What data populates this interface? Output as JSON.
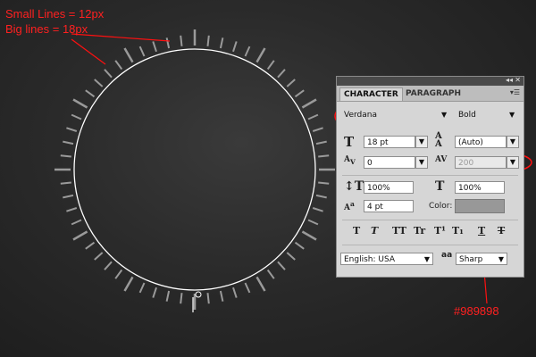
{
  "annotations": {
    "line1": "Small Lines = 12px",
    "line2": "Big lines = 18px",
    "color_note": "#989898",
    "accent_color": "#ff2020"
  },
  "panel": {
    "tabs": [
      {
        "label": "CHARACTER",
        "active": true
      },
      {
        "label": "PARAGRAPH",
        "active": false
      }
    ],
    "font_family": "Verdana",
    "font_style": "Bold",
    "font_size": "18 pt",
    "leading": "(Auto)",
    "kerning": "0",
    "tracking": "200",
    "vertical_scale": "100%",
    "horizontal_scale": "100%",
    "baseline_shift": "4 pt",
    "color_label": "Color:",
    "color_value": "#989898",
    "language": "English: USA",
    "antialias_icon_text": "a",
    "antialias": "Sharp",
    "style_buttons": [
      "T",
      "T",
      "TT",
      "Tr",
      "T¹",
      "T₁",
      "T",
      "T"
    ]
  }
}
